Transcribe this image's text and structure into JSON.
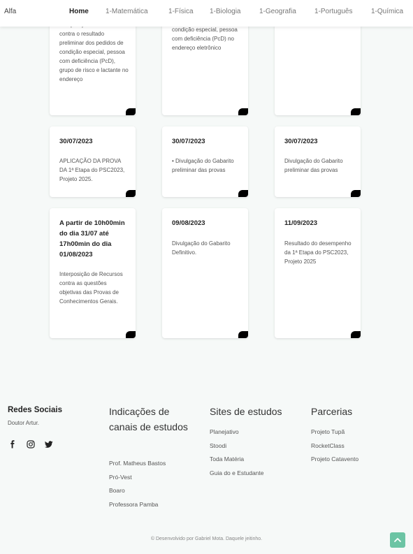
{
  "navbar": {
    "brand": "Alfa",
    "items": [
      {
        "label": "Home",
        "active": true
      },
      {
        "label": "1-Matemática"
      },
      {
        "label": "1-Física"
      },
      {
        "label": "1-Biologia"
      },
      {
        "label": "1-Geografia"
      },
      {
        "label": "1-Português"
      },
      {
        "label": "1-Química"
      }
    ]
  },
  "timeline": {
    "cards": [
      {
        "date": "",
        "desc": "Interposição de recursos contra o resultado preliminar dos pedidos de condição especial, pessoa com deficiência (PcD), grupo de risco e lactante no endereço"
      },
      {
        "date": "",
        "desc": "condição especial, pessoa com deficiência (PcD) no endereço eletrônico"
      },
      {
        "date": "",
        "desc": ""
      },
      {
        "date": "30/07/2023",
        "desc": "APLICAÇÃO DA PROVA DA 1ª Etapa do PSC2023, Projeto 2025."
      },
      {
        "date": "30/07/2023",
        "desc": "• Divulgação do Gabarito preliminar das provas"
      },
      {
        "date": "30/07/2023",
        "desc": "Divulgação do Gabarito preliminar das provas"
      },
      {
        "date": "A partir de 10h00min do dia 31/07 até 17h00min do dia 01/08/2023",
        "desc": "Interposição de Recursos contra as questões objetivas das Provas de Conhecimentos Gerais."
      },
      {
        "date": "09/08/2023",
        "desc": "Divulgação do Gabarito Definitivo."
      },
      {
        "date": "11/09/2023",
        "desc": "Resultado do desempenho da 1ª Etapa do PSC2023, Projeto 2025"
      }
    ]
  },
  "footer": {
    "social": {
      "title": "Redes Sociais",
      "subtitle": "Doutor Artur.",
      "icons": [
        "facebook-icon",
        "instagram-icon",
        "twitter-icon"
      ]
    },
    "channels": {
      "title": "Indicações de canais de estudos",
      "links": [
        "Prof. Matheus Bastos",
        "Pró-Vest",
        "Boaro",
        "Professora Pamba"
      ]
    },
    "sites": {
      "title": "Sites de estudos",
      "links": [
        "Planejativo",
        "Stoodi",
        "Toda Matéria",
        "Guia do e Estudante"
      ]
    },
    "partners": {
      "title": "Parcerias",
      "links": [
        "Projeto Tupã",
        "RocketClass",
        "Projeto Catavento"
      ]
    },
    "copyright": "© Desenvolvido por Gabriel Mota. Daquele jeitinho."
  },
  "colors": {
    "accent": "#6cc4a4",
    "background": "#f6f9f8"
  }
}
